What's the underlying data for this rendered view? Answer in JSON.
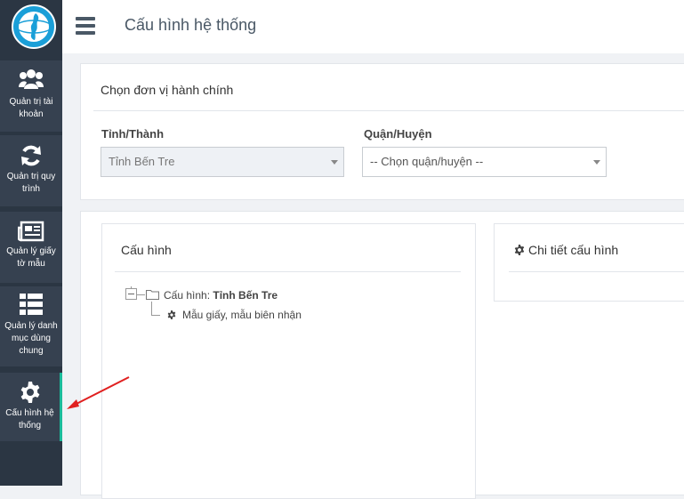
{
  "header": {
    "title": "Cấu hình hệ thống"
  },
  "sidebar": {
    "items": [
      {
        "label": "Quản trị tài khoản",
        "icon": "users-icon"
      },
      {
        "label": "Quản trị quy trình",
        "icon": "refresh-icon"
      },
      {
        "label": "Quản lý giấy tờ mẫu",
        "icon": "newspaper-icon"
      },
      {
        "label": "Quản lý danh mục dùng chung",
        "icon": "list-icon"
      },
      {
        "label": "Cấu hình hệ thống",
        "icon": "gear-icon",
        "active": true
      }
    ]
  },
  "admin_unit": {
    "title": "Chọn đơn vị hành chính",
    "province_label": "Tỉnh/Thành",
    "province_value": "Tỉnh Bến Tre",
    "district_label": "Quận/Huyện",
    "district_value": "-- Chọn quận/huyện --"
  },
  "config": {
    "title": "Cấu hình",
    "root_prefix": "Cấu hình:",
    "root_name": "Tỉnh Bến Tre",
    "child": "Mẫu giấy, mẫu biên nhận"
  },
  "detail": {
    "title": "Chi tiết cấu hình"
  },
  "colors": {
    "sidebar": "#2b3643",
    "nav_item": "#364150",
    "active_border": "#1bbc9b",
    "arrow": "#e02020"
  }
}
